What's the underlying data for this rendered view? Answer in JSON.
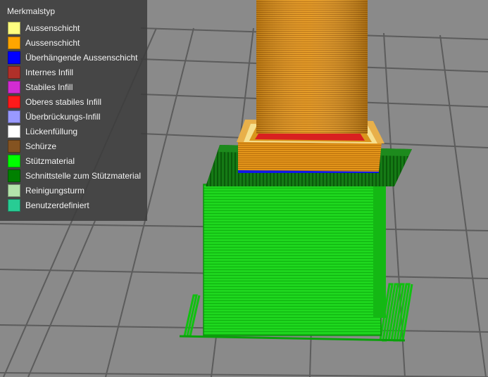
{
  "legend": {
    "title": "Merkmalstyp",
    "items": [
      {
        "label": "Aussenschicht",
        "color": "#ffff80"
      },
      {
        "label": "Aussenschicht",
        "color": "#ffa500"
      },
      {
        "label": "Überhängende Aussenschicht",
        "color": "#0000ff"
      },
      {
        "label": "Internes Infill",
        "color": "#b03029"
      },
      {
        "label": "Stabiles Infill",
        "color": "#d22cd2"
      },
      {
        "label": "Oberes stabiles Infill",
        "color": "#ff1a1a"
      },
      {
        "label": "Überbrückungs-Infill",
        "color": "#9999ff"
      },
      {
        "label": "Lückenfüllung",
        "color": "#ffffff"
      },
      {
        "label": "Schürze",
        "color": "#845321"
      },
      {
        "label": "Stützmaterial",
        "color": "#00ff00"
      },
      {
        "label": "Schnittstelle zum Stützmaterial",
        "color": "#008000"
      },
      {
        "label": "Reinigungsturm",
        "color": "#b3e3ab"
      },
      {
        "label": "Benutzerdefiniert",
        "color": "#28cc94"
      }
    ]
  },
  "scene": {
    "background_color": "#8a8a8a",
    "grid_color": "#5c5c5c"
  }
}
